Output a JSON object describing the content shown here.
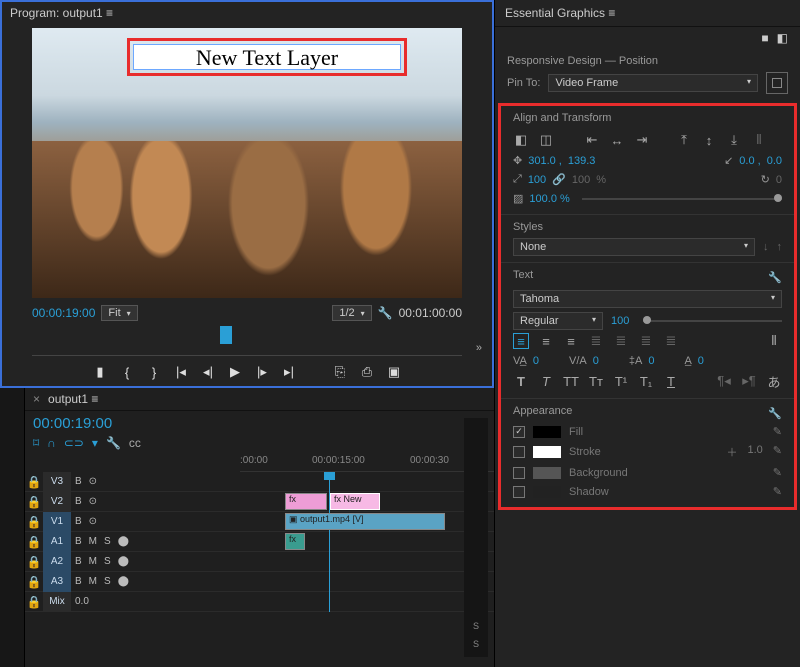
{
  "program": {
    "title": "Program: output1  ≡",
    "text_layer": "New Text Layer",
    "timecode": "00:00:19:00",
    "fit_label": "Fit",
    "scale_label": "1/2",
    "duration": "00:01:00:00"
  },
  "timeline": {
    "tab": "output1  ≡",
    "timecode": "00:00:19:00",
    "ruler": {
      "a": ":00:00",
      "b": "00:00:15:00",
      "c": "00:00:30"
    },
    "tracks": {
      "v3": "V3",
      "v2": "V2",
      "v1": "V1",
      "a1": "A1",
      "a2": "A2",
      "a3": "A3",
      "mix": "Mix"
    },
    "clips": {
      "v2a": "fx",
      "v2b": "fx  New",
      "v1": "output1.mp4 [V]",
      "a1": "fx"
    },
    "ctl": {
      "b": "B",
      "o": "⊙",
      "m": "M",
      "s": "S",
      "mic": "⬤"
    }
  },
  "eg": {
    "title": "Essential Graphics  ≡",
    "responsive": "Responsive Design — Position",
    "pinto_label": "Pin To:",
    "pinto": "Video Frame",
    "align": "Align and Transform",
    "pos_x": "301.0 ,",
    "pos_y": "139.3",
    "anchor_x": "0.0 ,",
    "anchor_y": "0.0",
    "scale": "100",
    "scale2": "100",
    "pct": "%",
    "opacity": "100.0 %",
    "styles": "Styles",
    "style_sel": "None",
    "text": "Text",
    "font": "Tahoma",
    "weight": "Regular",
    "size": "100",
    "track1": "0",
    "track2": "0",
    "track3": "0",
    "track4": "0",
    "appearance": "Appearance",
    "fill": "Fill",
    "stroke": "Stroke",
    "stroke_w": "1.0",
    "background": "Background",
    "shadow": "Shadow"
  }
}
